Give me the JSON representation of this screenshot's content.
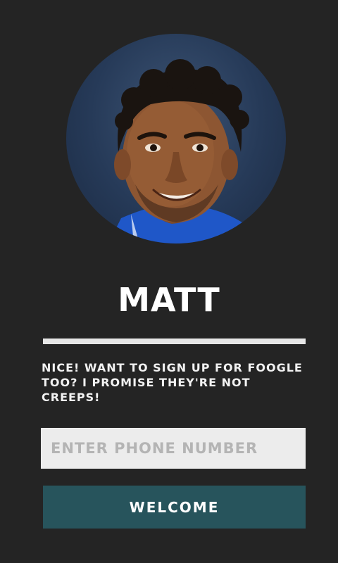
{
  "profile": {
    "photo_alt": "profile photo",
    "name": "MATT"
  },
  "message": "NICE! WANT TO SIGN UP FOR FOOGLE TOO? I PROMISE THEY'RE NOT CREEPS!",
  "phone_input": {
    "placeholder": "ENTER PHONE NUMBER",
    "value": ""
  },
  "welcome_button": {
    "label": "WELCOME"
  },
  "colors": {
    "background": "#242424",
    "divider": "#e6e6e6",
    "input_background": "#ececec",
    "button_background": "#27545c",
    "text": "#ffffff"
  }
}
